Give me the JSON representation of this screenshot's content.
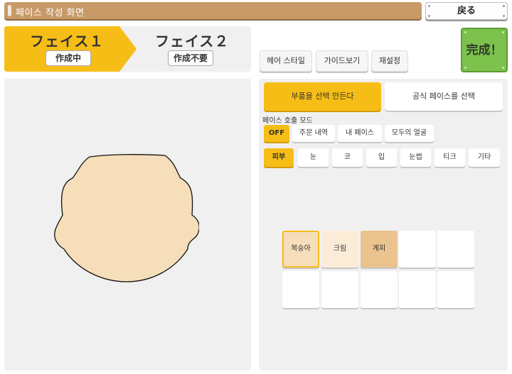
{
  "window": {
    "title": "페이스 작성 화면",
    "back_label": "戻る"
  },
  "faces": [
    {
      "label": "フェイス１",
      "status": "作成中"
    },
    {
      "label": "フェイス２",
      "status": "作成不要"
    }
  ],
  "toolbar": {
    "hair_label": "헤어 스타일",
    "guide_label": "가이드보기",
    "reset_label": "재설정",
    "done_label": "完成！"
  },
  "modes": {
    "select_parts_label": "부품을 선택 만든다",
    "official_label": "공식 페이스를 선택"
  },
  "call_mode": {
    "label": "페이스 호출 모드",
    "options": [
      "OFF",
      "주문 내역",
      "내 페이스",
      "모두의 얼굴"
    ],
    "selected": "OFF"
  },
  "parts": {
    "tabs": [
      "피부",
      "눈",
      "코",
      "입",
      "눈썹",
      "티크",
      "기타"
    ],
    "selected": "피부"
  },
  "skin_colors": [
    {
      "label": "복숭아",
      "color": "#f5deb9",
      "selected": true
    },
    {
      "label": "크림",
      "color": "#fcecd7",
      "selected": false
    },
    {
      "label": "계피",
      "color": "#ebc38f",
      "selected": false
    }
  ],
  "colors": {
    "accent": "#f7bd17",
    "title_bar": "#c89a68",
    "done": "#7cc24d",
    "face_fill": "#f5deb9"
  }
}
